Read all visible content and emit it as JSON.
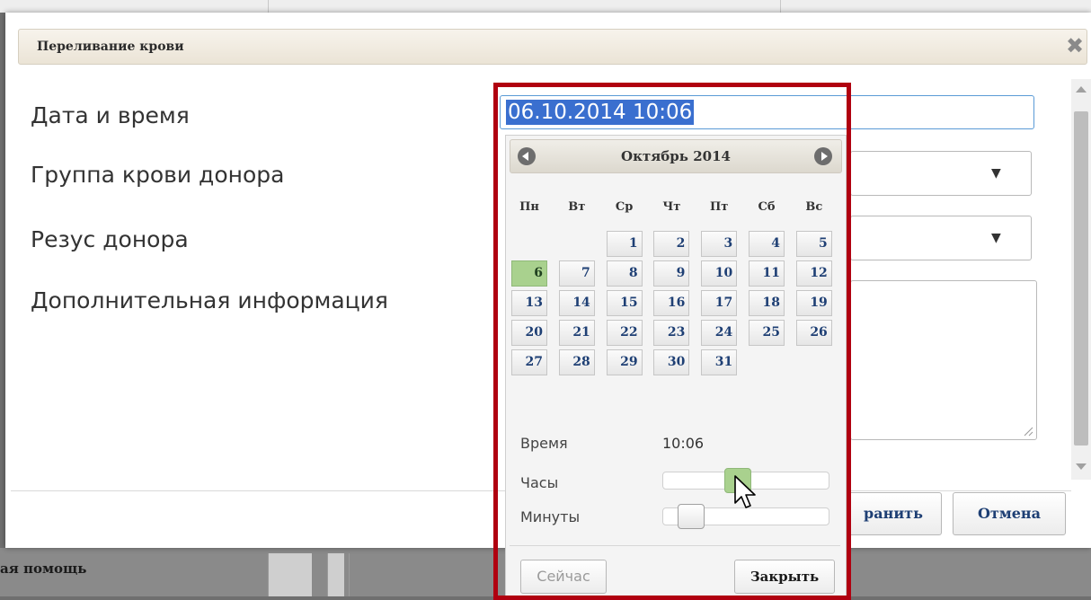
{
  "dialog": {
    "title": "Переливание крови",
    "close_icon": "close-icon"
  },
  "form": {
    "labels": {
      "date_time": "Дата и время",
      "donor_blood_group": "Группа крови донора",
      "donor_rhesus": "Резус донора",
      "additional_info": "Дополнительная информация"
    },
    "date_time_value": "06.10.2014 10:06"
  },
  "calendar": {
    "month_year": "Октябрь 2014",
    "prev_icon": "prev-month-icon",
    "next_icon": "next-month-icon",
    "weekdays": [
      "Пн",
      "Вт",
      "Ср",
      "Чт",
      "Пт",
      "Сб",
      "Вс"
    ],
    "weeks": [
      [
        "",
        "",
        "1",
        "2",
        "3",
        "4",
        "5"
      ],
      [
        "6",
        "7",
        "8",
        "9",
        "10",
        "11",
        "12"
      ],
      [
        "13",
        "14",
        "15",
        "16",
        "17",
        "18",
        "19"
      ],
      [
        "20",
        "21",
        "22",
        "23",
        "24",
        "25",
        "26"
      ],
      [
        "27",
        "28",
        "29",
        "30",
        "31",
        "",
        ""
      ]
    ],
    "selected_day": "6",
    "time_label": "Время",
    "time_value": "10:06",
    "hours_label": "Часы",
    "minutes_label": "Минуты",
    "hours_value": 10,
    "hours_max": 23,
    "minutes_value": 6,
    "minutes_max": 59,
    "now_button": "Сейчас",
    "close_button": "Закрыть",
    "today_color": "#a9d18e"
  },
  "footer": {
    "save_button": "ранить",
    "cancel_button": "Отмена"
  },
  "background": {
    "bottom_text": "ая помощь"
  },
  "highlight": {
    "color": "#b00010"
  }
}
